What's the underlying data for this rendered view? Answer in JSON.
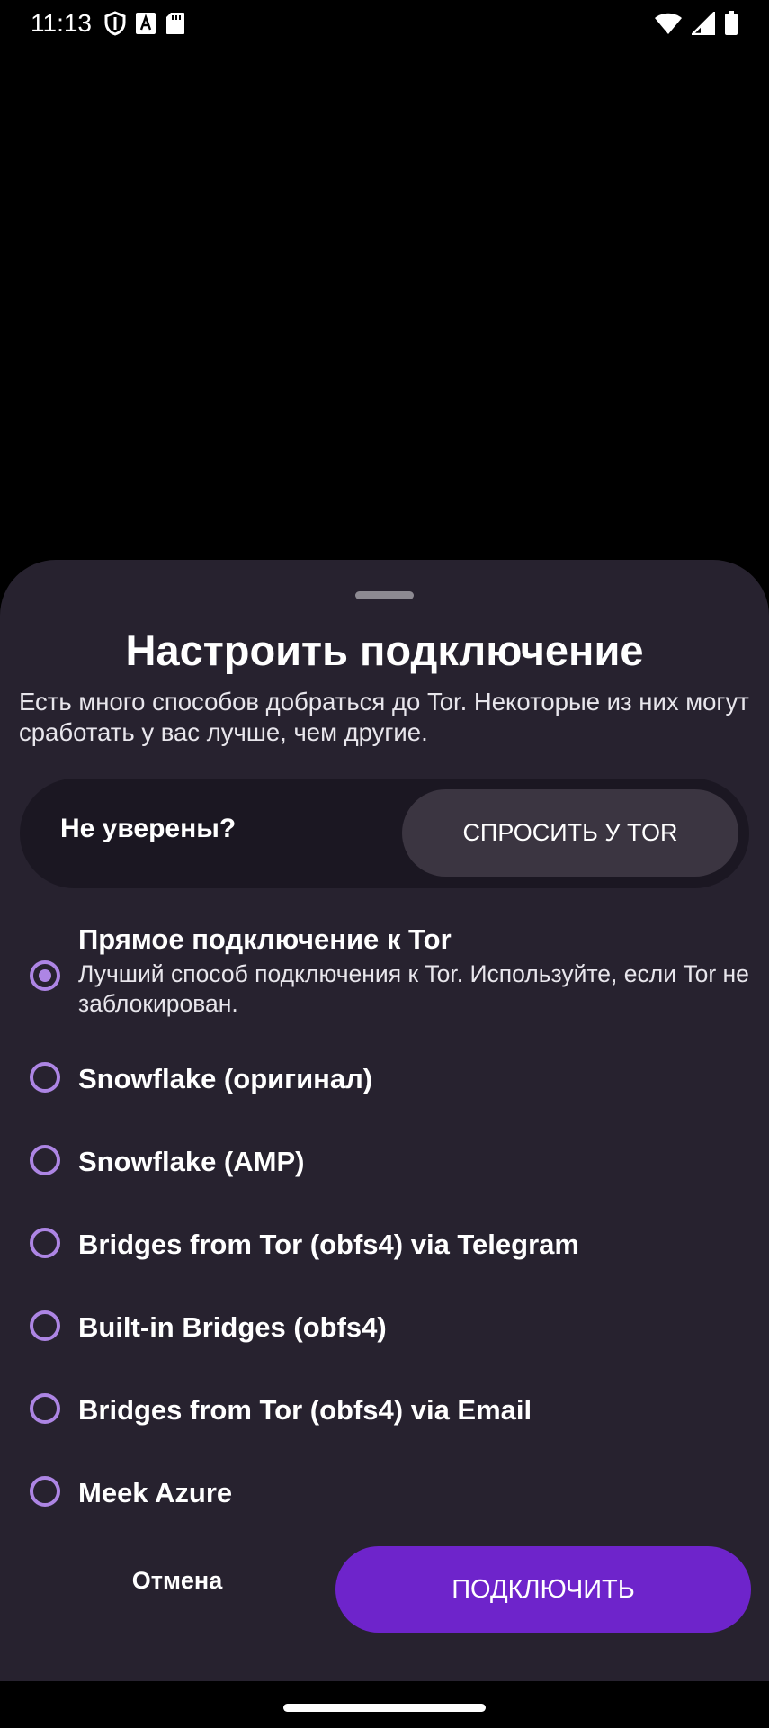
{
  "status_bar": {
    "time": "11:13",
    "left_icons": [
      "shield-icon",
      "font-a-icon",
      "sd-card-icon"
    ],
    "right_icons": [
      "wifi-icon",
      "cell-signal-icon",
      "battery-icon"
    ]
  },
  "sheet": {
    "title": "Настроить подключение",
    "description": "Есть много способов добраться до Tor. Некоторые из них могут сработать у вас лучше, чем другие.",
    "unsure": {
      "label": "Не уверены?",
      "ask_button": "СПРОСИТЬ У TOR"
    },
    "options": [
      {
        "title": "Прямое подключение к Tor",
        "description": "Лучший способ подключения к Tor. Используйте, если Tor не заблокирован.",
        "selected": true
      },
      {
        "title": "Snowflake (оригинал)",
        "selected": false
      },
      {
        "title": "Snowflake (AMP)",
        "selected": false
      },
      {
        "title": "Bridges from Tor (obfs4) via Telegram",
        "selected": false
      },
      {
        "title": "Built-in Bridges (obfs4)",
        "selected": false
      },
      {
        "title": "Bridges from Tor (obfs4) via Email",
        "selected": false
      },
      {
        "title": "Meek Azure",
        "selected": false
      }
    ],
    "cancel_label": "Отмена",
    "connect_label": "ПОДКЛЮЧИТЬ"
  },
  "colors": {
    "sheet_background": "#27222f",
    "card_background": "#1b1722",
    "accent": "#6e24cb",
    "radio": "#ad85e4"
  }
}
